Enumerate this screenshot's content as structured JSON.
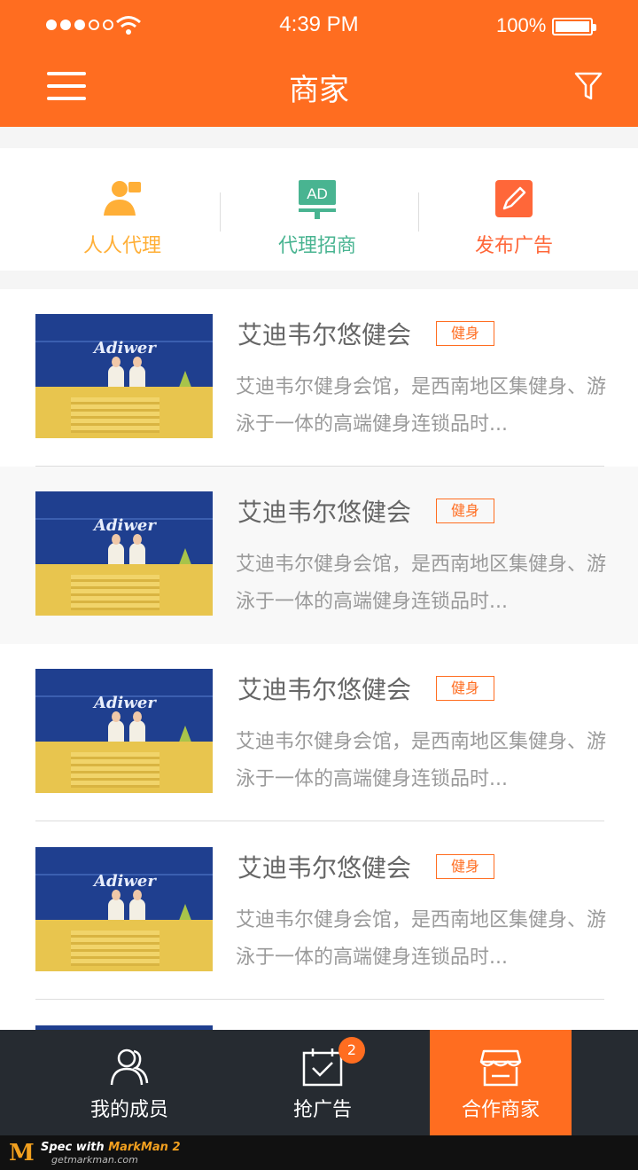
{
  "status_bar": {
    "time": "4:39 PM",
    "battery": "100%"
  },
  "nav": {
    "title": "商家"
  },
  "categories": [
    {
      "label": "人人代理",
      "icon": "person-icon",
      "color": "#ffaf37"
    },
    {
      "label": "代理招商",
      "icon": "ad-icon",
      "color": "#49b491"
    },
    {
      "label": "发布广告",
      "icon": "edit-icon",
      "color": "#ff6739"
    }
  ],
  "items": [
    {
      "name": "艾迪韦尔悠健会",
      "tag": "健身",
      "desc": "艾迪韦尔健身会馆，是西南地区集健身、游泳于一体的高端健身连锁品时...",
      "logo": "Adiwer"
    },
    {
      "name": "艾迪韦尔悠健会",
      "tag": "健身",
      "desc": "艾迪韦尔健身会馆，是西南地区集健身、游泳于一体的高端健身连锁品时...",
      "logo": "Adiwer"
    },
    {
      "name": "艾迪韦尔悠健会",
      "tag": "健身",
      "desc": "艾迪韦尔健身会馆，是西南地区集健身、游泳于一体的高端健身连锁品时...",
      "logo": "Adiwer"
    },
    {
      "name": "艾迪韦尔悠健会",
      "tag": "健身",
      "desc": "艾迪韦尔健身会馆，是西南地区集健身、游泳于一体的高端健身连锁品时...",
      "logo": "Adiwer"
    }
  ],
  "tabs": [
    {
      "label": "我的成员",
      "icon": "members-icon"
    },
    {
      "label": "抢广告",
      "icon": "calendar-check-icon",
      "badge": "2"
    },
    {
      "label": "合作商家",
      "icon": "store-icon",
      "active": true
    }
  ],
  "footer": {
    "spec_prefix": "Spec with ",
    "product": "MarkMan 2",
    "site": "getmarkman.com"
  },
  "colors": {
    "brand": "#ff6d20",
    "text_title": "#666666",
    "text_desc": "#9a9a9a",
    "divider": "#dddddd",
    "tabbar": "#262b31"
  }
}
